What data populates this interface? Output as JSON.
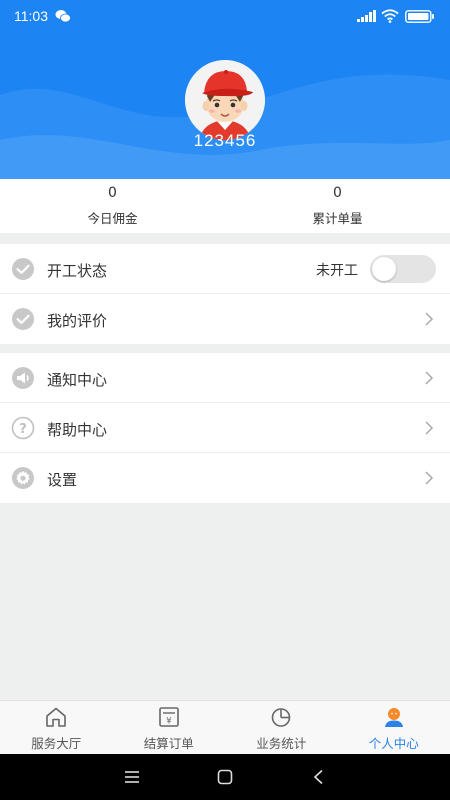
{
  "status_bar": {
    "time": "11:03",
    "icons": [
      "wechat-icon",
      "signal-icon",
      "wifi-icon",
      "battery-icon"
    ]
  },
  "profile": {
    "username": "123456",
    "avatar": "avatar-cartoon-red-cap"
  },
  "stats": [
    {
      "value": "0",
      "label": "今日佣金"
    },
    {
      "value": "0",
      "label": "累计单量"
    }
  ],
  "menu": {
    "work_status": {
      "label": "开工状态",
      "status": "未开工",
      "on": false,
      "icon": "check-badge-icon"
    },
    "my_reviews": {
      "label": "我的评价",
      "icon": "check-badge-icon"
    },
    "notifications": {
      "label": "通知中心",
      "icon": "megaphone-icon"
    },
    "help": {
      "label": "帮助中心",
      "icon": "question-icon"
    },
    "settings": {
      "label": "设置",
      "icon": "gear-icon"
    }
  },
  "tabs": [
    {
      "label": "服务大厅",
      "icon": "home-icon",
      "active": false
    },
    {
      "label": "结算订单",
      "icon": "receipt-icon",
      "active": false
    },
    {
      "label": "业务统计",
      "icon": "pie-chart-icon",
      "active": false
    },
    {
      "label": "个人中心",
      "icon": "person-icon",
      "active": true
    }
  ],
  "colors": {
    "header_blue": "#1d85f3",
    "active_tab": "#2b83e9",
    "page_background": "#eef0f0"
  }
}
